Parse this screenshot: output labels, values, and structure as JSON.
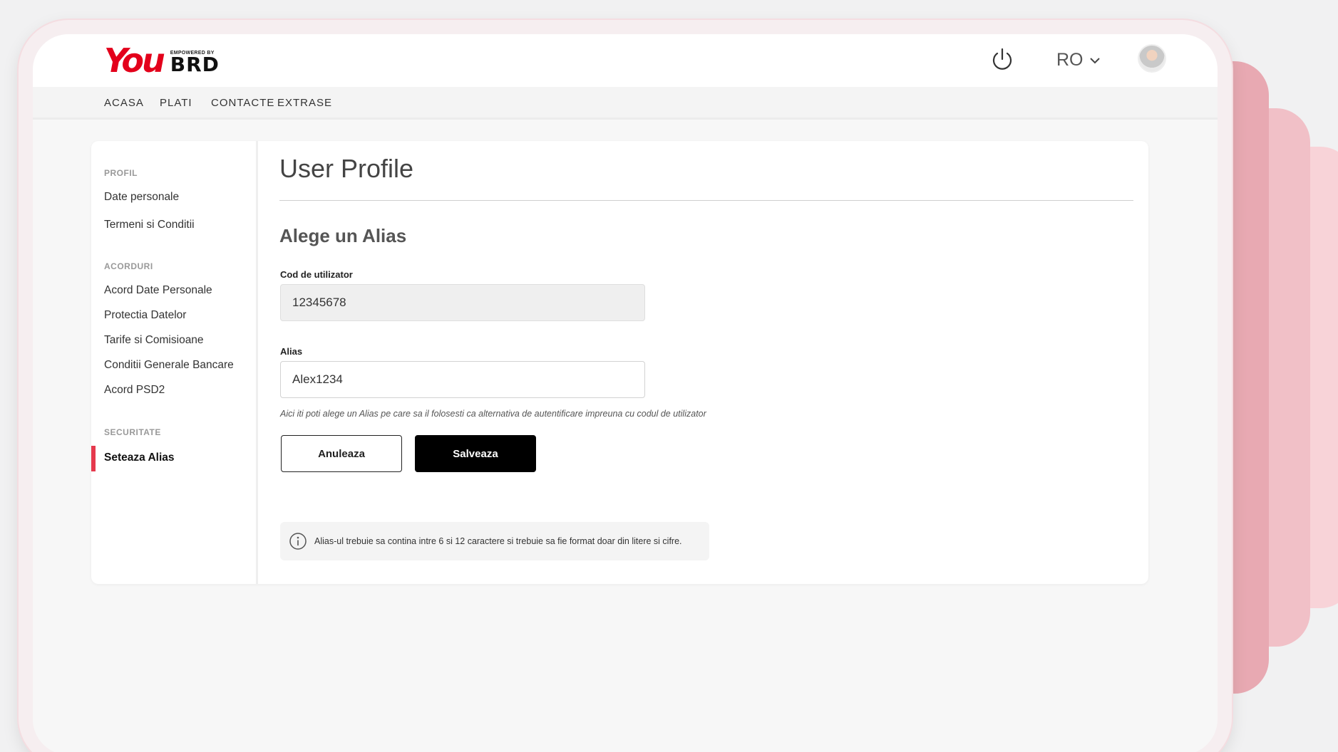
{
  "brand": {
    "logo_main": "You",
    "logo_tagline": "EMPOWERED BY",
    "logo_bank": "BRD",
    "accent_color": "#e3001b"
  },
  "header": {
    "language": "RO",
    "power_icon": "power-icon",
    "avatar_icon": "user-avatar"
  },
  "nav": {
    "items": [
      "ACASA",
      "PLATI",
      "CONTACTE",
      "EXTRASE"
    ]
  },
  "sidebar": {
    "sections": [
      {
        "title": "PROFIL",
        "items": [
          "Date personale",
          "Termeni si Conditii"
        ]
      },
      {
        "title": "ACORDURI",
        "items": [
          "Acord Date Personale",
          "Protectia Datelor",
          "Tarife si Comisioane",
          "Conditii Generale Bancare",
          "Acord PSD2"
        ]
      },
      {
        "title": "SECURITATE",
        "items": [
          "Seteaza Alias"
        ]
      }
    ],
    "active_item": "Seteaza Alias",
    "active_color": "#e5394d"
  },
  "main": {
    "title": "User Profile",
    "section_title": "Alege un Alias",
    "user_code_label": "Cod de utilizator",
    "user_code_value": "12345678",
    "alias_label": "Alias",
    "alias_value": "Alex1234",
    "hint": "Aici iti poti alege un Alias pe care sa il folosesti ca alternativa de autentificare impreuna cu codul de utilizator",
    "cancel_label": "Anuleaza",
    "save_label": "Salveaza",
    "info_text": "Alias-ul trebuie sa contina intre 6 si 12 caractere si trebuie sa fie format doar din litere si cifre."
  }
}
